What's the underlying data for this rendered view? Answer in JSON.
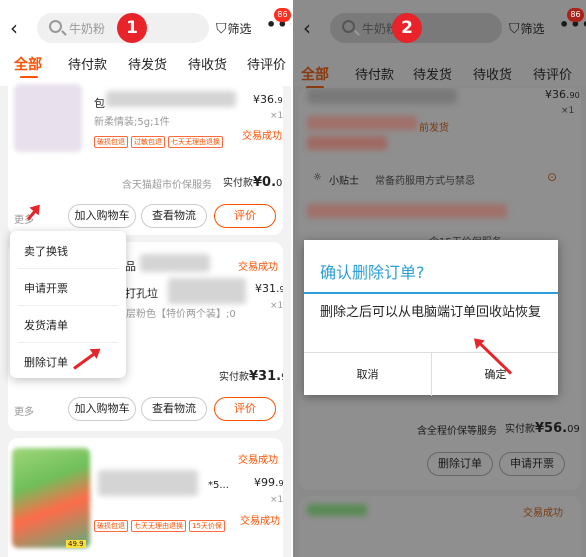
{
  "step_badges": [
    "1",
    "2"
  ],
  "header": {
    "back_icon": "‹",
    "search_placeholder": "牛奶粉",
    "filter_label": "筛选",
    "more_icon": "•••",
    "badge_count": "86"
  },
  "tabs": [
    "全部",
    "待付款",
    "待发货",
    "待收货",
    "待评价"
  ],
  "panel1": {
    "order1": {
      "title_prefix": "包",
      "price": "¥36.",
      "price_dec": "90",
      "qty": "×1",
      "spec": "新柔情装;5g;1件",
      "tags": [
        "破损包退",
        "过敏包退",
        "七天无理由退换"
      ],
      "status": "交易成功",
      "service": "含天猫超市价保服务",
      "paid_label": "实付款",
      "paid_amount": "¥0.",
      "paid_dec": "00",
      "more": "更多",
      "btn_cart": "加入购物车",
      "btn_logistics": "查看物流",
      "btn_review": "评价"
    },
    "order2": {
      "status": "交易成功",
      "title_frag1": "品",
      "title_frag2": "打孔垃",
      "spec": "层粉色【特价两个装】;0",
      "price": "¥31.",
      "price_dec": "90",
      "qty": "×1",
      "paid_label": "实付款",
      "paid_amount": "¥31.",
      "paid_dec": "90",
      "more": "更多",
      "btn_cart": "加入购物车",
      "btn_logistics": "查看物流",
      "btn_review": "评价"
    },
    "order3": {
      "status": "交易成功",
      "title_frag": "*5...",
      "price": "¥99.",
      "price_dec": "90",
      "qty": "×1",
      "status2": "交易成功",
      "tags": [
        "破损包退",
        "七天无理由退换",
        "15天价保"
      ],
      "thumb_price": "49.9"
    },
    "menu": [
      "卖了换钱",
      "申请开票",
      "发货清单",
      "删除订单"
    ]
  },
  "panel2": {
    "price_top": "¥36.",
    "price_top_dec": "90",
    "qty_top": "×1",
    "shipping_frag": "前发货",
    "tip_label": "小贴士",
    "tip_text": "常备药服用方式与禁忌",
    "price_guard_frag": "含15天价保服务",
    "dialog": {
      "title": "确认删除订单?",
      "message": "删除之后可以从电脑端订单回收站恢复",
      "cancel": "取消",
      "confirm": "确定"
    },
    "paid_service": "含全程价保等服务",
    "paid_label": "实付款",
    "paid_amount": "¥56.",
    "paid_dec": "09",
    "btn_delete": "删除订单",
    "btn_invoice": "申请开票",
    "status_bottom": "交易成功"
  }
}
